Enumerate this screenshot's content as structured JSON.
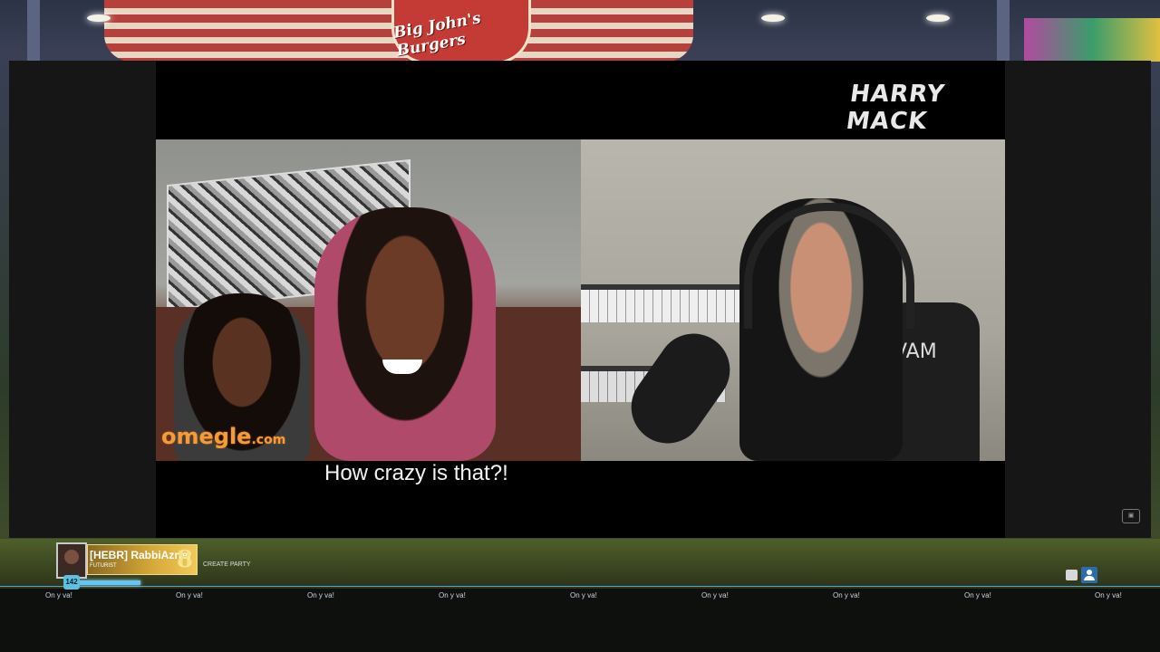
{
  "scene": {
    "restaurant_sign": "Big John's Burgers"
  },
  "video": {
    "brand_logo": "HARRY MACK",
    "watermark": "omegle",
    "watermark_suffix": ".com",
    "caption": "How crazy is that?!",
    "chair_logo": "VAM",
    "corner_badge": "icon"
  },
  "hud": {
    "player_name": "[HEBR] RabbiAzriel",
    "player_title": "FUTURIST",
    "rank_number": "8",
    "level": "142",
    "create_party": "CREATE PARTY",
    "chat_messages": [
      "On y va!",
      "On y va!",
      "On y va!",
      "On y va!",
      "On y va!",
      "On y va!",
      "On y va!",
      "On y va!",
      "On y va!"
    ],
    "xp_progress": 0.85
  },
  "icons": {
    "chat": "chat-icon",
    "friends": "friends-icon"
  }
}
